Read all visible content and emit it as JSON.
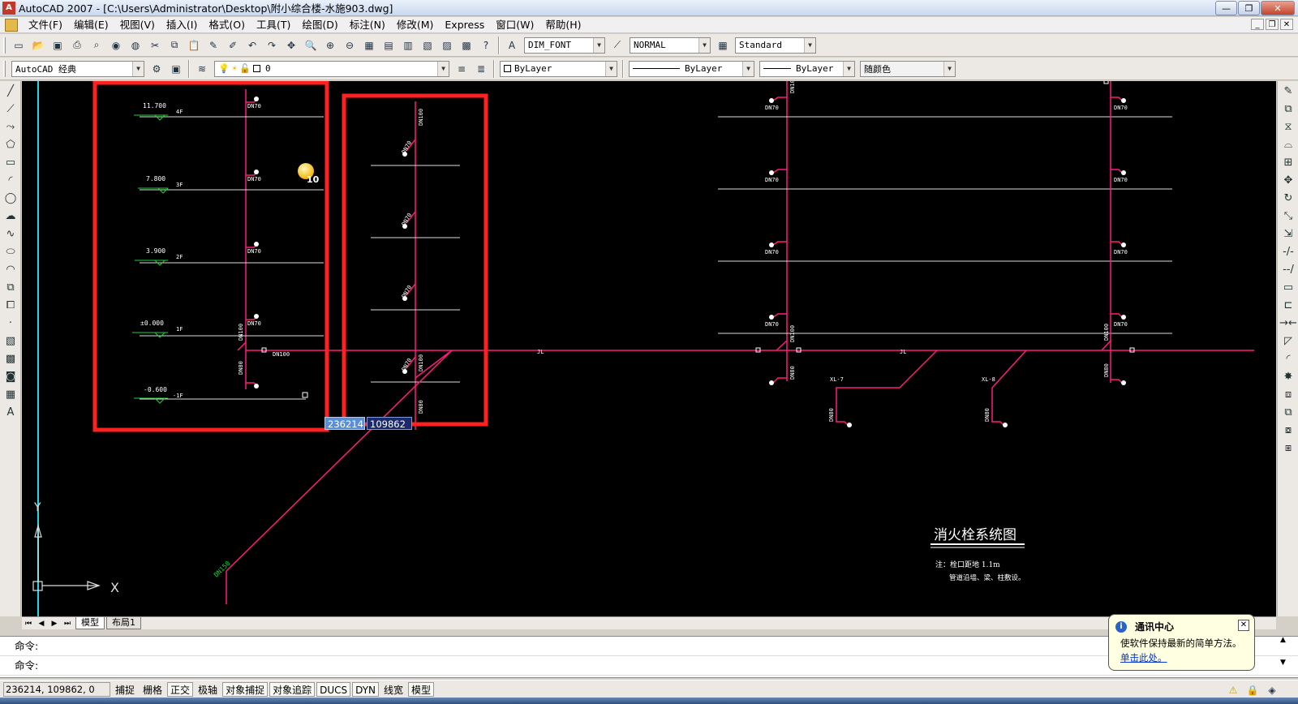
{
  "window": {
    "title": "AutoCAD 2007 - [C:\\Users\\Administrator\\Desktop\\附小综合楼-水施903.dwg]",
    "app_icon": "autocad-logo-icon"
  },
  "menu": [
    "文件(F)",
    "编辑(E)",
    "视图(V)",
    "插入(I)",
    "格式(O)",
    "工具(T)",
    "绘图(D)",
    "标注(N)",
    "修改(M)",
    "Express",
    "窗口(W)",
    "帮助(H)"
  ],
  "toolbar1": {
    "text_style": "DIM_FONT",
    "dim_style": "NORMAL",
    "table_style": "Standard"
  },
  "toolbar2": {
    "workspace": "AutoCAD 经典",
    "layer": "0",
    "color": "ByLayer",
    "linetype": "ByLayer",
    "lineweight": "ByLayer",
    "plot_style": "随颜色"
  },
  "drawing": {
    "elevations": [
      "11.700",
      "7.800",
      "3.900",
      "±0.000",
      "-0.600"
    ],
    "floors": [
      "4F",
      "3F",
      "2F",
      "1F",
      "-1F"
    ],
    "pipe_labels": {
      "dn70": "DN70",
      "dn100": "DN100",
      "dn80": "DN80",
      "dn150": "DN150",
      "jl": "JL"
    },
    "riser_labels": [
      "XL-7",
      "XL-8"
    ],
    "system_title": "消火栓系统图",
    "note_line1": "注：栓口距地 1.1m",
    "note_line2": "管道沿墙、梁、柱敷设。",
    "dyn_x": "236214",
    "dyn_y": "109862",
    "notification_count": "10",
    "ucs_x": "X",
    "ucs_y": "Y",
    "highlight_color": "#ff2020",
    "pipe_color": "#ff1c7a"
  },
  "tabs": [
    "模型",
    "布局1"
  ],
  "command": {
    "line1": "命令:",
    "line2": "命令:"
  },
  "status": {
    "coords": "236214, 109862, 0",
    "buttons": [
      "捕捉",
      "栅格",
      "正交",
      "极轴",
      "对象捕捉",
      "对象追踪",
      "DUCS",
      "DYN",
      "线宽",
      "模型"
    ]
  },
  "notification": {
    "title": "通讯中心",
    "body": "使软件保持最新的简单方法。",
    "link": "单击此处。"
  }
}
